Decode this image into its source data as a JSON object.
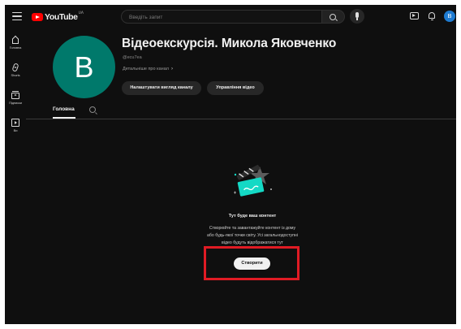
{
  "topbar": {
    "logo_text": "YouTube",
    "logo_country": "UA",
    "search_placeholder": "Введіть запит"
  },
  "account": {
    "avatar_letter": "В"
  },
  "sidebar": {
    "items": [
      {
        "label": "Головна",
        "icon": "home-icon"
      },
      {
        "label": "Shorts",
        "icon": "shorts-icon"
      },
      {
        "label": "Підписки",
        "icon": "subscriptions-icon"
      },
      {
        "label": "Ви",
        "icon": "you-icon"
      }
    ]
  },
  "channel": {
    "avatar_letter": "В",
    "title": "Відеоекскурсія. Микола Яковченко",
    "handle": "@ecu7ea",
    "about_link": "Детальніше про канал",
    "customize_button": "Налаштувати вигляд каналу",
    "manage_button": "Управління відео"
  },
  "tabs": {
    "home": "Головна"
  },
  "empty_state": {
    "title": "Тут буде ваш контент",
    "line1": "Створюйте та завантажуйте контент із дому",
    "line2": "або будь-якої точки світу. Усі загальнодоступні",
    "line3": "відео будуть відображатися тут",
    "create_button": "Створити"
  },
  "colors": {
    "background": "#0f0f0f",
    "channel_avatar": "#00796b",
    "highlight": "#e01b24",
    "brand_red": "#ff0000"
  }
}
